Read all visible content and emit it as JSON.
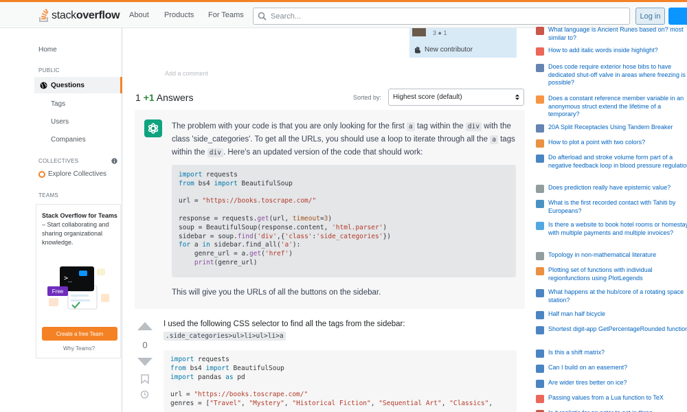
{
  "header": {
    "logo_light": "stack",
    "logo_bold": "overflow",
    "nav": [
      "About",
      "Products",
      "For Teams"
    ],
    "search_placeholder": "Search...",
    "login_label": "Log in"
  },
  "sidebar": {
    "home": "Home",
    "public_heading": "PUBLIC",
    "questions": "Questions",
    "tags": "Tags",
    "users": "Users",
    "companies": "Companies",
    "collectives_heading": "COLLECTIVES",
    "explore_collectives": "Explore Collectives",
    "teams_heading": "TEAMS",
    "teams_title": "Stack Overflow for Teams",
    "teams_desc": " – Start collaborating and sharing organizational knowledge.",
    "free_badge": "Free",
    "create_team": "Create a free Team",
    "why_teams": "Why Teams?"
  },
  "main": {
    "contributor_score": "3 ● 1",
    "new_contributor": "New contributor",
    "add_comment": "Add a comment",
    "answers_count_1": "1",
    "answers_count_2": "+1",
    "answers_label": "Answers",
    "sorted_by": "Sorted by:",
    "sort_value": "Highest score (default)",
    "ai_answer": {
      "p1_a": "The problem with your code is that you are only looking for the first ",
      "p1_code1": "a",
      "p1_b": " tag within the ",
      "p1_code2": "div",
      "p1_c": " with the class 'side_categories'. To get all the URLs, you should use a loop to iterate through all the ",
      "p1_code3": "a",
      "p1_d": " tags within the ",
      "p1_code4": "div",
      "p1_e": ". Here's an updated version of the code that should work:",
      "after": "This will give you the URLs of all the buttons on the sidebar."
    },
    "answer2": {
      "vote_count": "0",
      "text": "I used the following CSS selector to find all the tags from the sidebar:",
      "selector": ".side_categories>ul>li>ul>li>a"
    }
  },
  "right_questions": [
    {
      "icon": "ancient-runes-site-icon",
      "color": "#c0392b",
      "text": "What language is Ancient Runes based on? most similar to?"
    },
    {
      "icon": "brackets-site-icon",
      "color": "#e74c3c",
      "text": "How to add italic words inside highlight?"
    },
    {
      "icon": "diy-site-icon",
      "color": "#4a6fa5",
      "text": "Does code require exterior hose bibs to have dedicated shut-off valve in areas where freezing is possible?"
    },
    {
      "icon": "stackoverflow-site-icon",
      "color": "#f48225",
      "text": "Does a constant reference member variable in an anonymous struct extend the lifetime of a temporary?"
    },
    {
      "icon": "diy-site-icon",
      "color": "#4a6fa5",
      "text": "20A Split Receptacles Using Tandem Breaker"
    },
    {
      "icon": "math-site-icon",
      "color": "#e67e22",
      "text": "How to plot a point with two colors?"
    },
    {
      "icon": "electronics-site-icon",
      "color": "#2c6fb7",
      "text": "Do afterload and stroke volume form part of a negative feedback loop in blood pressure regulation?"
    },
    {
      "icon": "philosophy-site-icon",
      "color": "#7f8c8d",
      "text": "Does prediction really have epistemic value?"
    },
    {
      "icon": "history-site-icon",
      "color": "#2980b9",
      "text": "What is the first recorded contact with Tahiti by Europeans?"
    },
    {
      "icon": "travel-site-icon",
      "color": "#3498db",
      "text": "Is there a website to book hotel rooms or homestays with multiple payments and multiple invoices?"
    },
    {
      "icon": "math-site-icon",
      "color": "#7f8c8d",
      "text": "Topology in non-mathematical literature"
    },
    {
      "icon": "mathematica-site-icon",
      "color": "#e67e22",
      "text": "Plotting set of functions with individual regionfunctions using PlotLegends"
    },
    {
      "icon": "space-site-icon",
      "color": "#2c6fb7",
      "text": "What happens at the hub/core of a rotating space station?"
    },
    {
      "icon": "bicycles-site-icon",
      "color": "#2c6fb7",
      "text": "Half man half bicycle"
    },
    {
      "icon": "codegolf-site-icon",
      "color": "#2c6fb7",
      "text": "Shortest digit-app GetPercentageRounded function"
    },
    {
      "icon": "puzzling-site-icon",
      "color": "#2c6fb7",
      "text": "Is this a shift matrix?"
    },
    {
      "icon": "law-site-icon",
      "color": "#2c6fb7",
      "text": "Can I build on an easement?"
    },
    {
      "icon": "bicycles-site-icon",
      "color": "#2c6fb7",
      "text": "Are wider tires better on ice?"
    },
    {
      "icon": "brackets-site-icon",
      "color": "#e74c3c",
      "text": "Passing values from a Lua function to TeX"
    },
    {
      "icon": "movies-site-icon",
      "color": "#c0392b",
      "text": "Is it realistic for an actor to act in three"
    }
  ]
}
